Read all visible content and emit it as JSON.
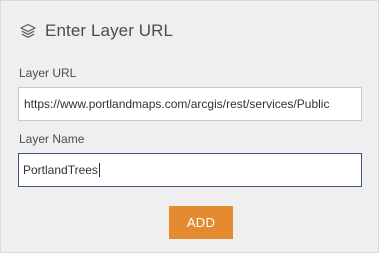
{
  "header": {
    "title": "Enter Layer URL",
    "icon": "layers-icon"
  },
  "form": {
    "url_label": "Layer URL",
    "url_value": "https://www.portlandmaps.com/arcgis/rest/services/Public",
    "name_label": "Layer Name",
    "name_value": "PortlandTrees"
  },
  "actions": {
    "add_label": "ADD"
  },
  "colors": {
    "panel_bg": "#efefef",
    "accent": "#e48a30",
    "focus_border": "#3d5a7c",
    "text": "#4c4c4c"
  }
}
